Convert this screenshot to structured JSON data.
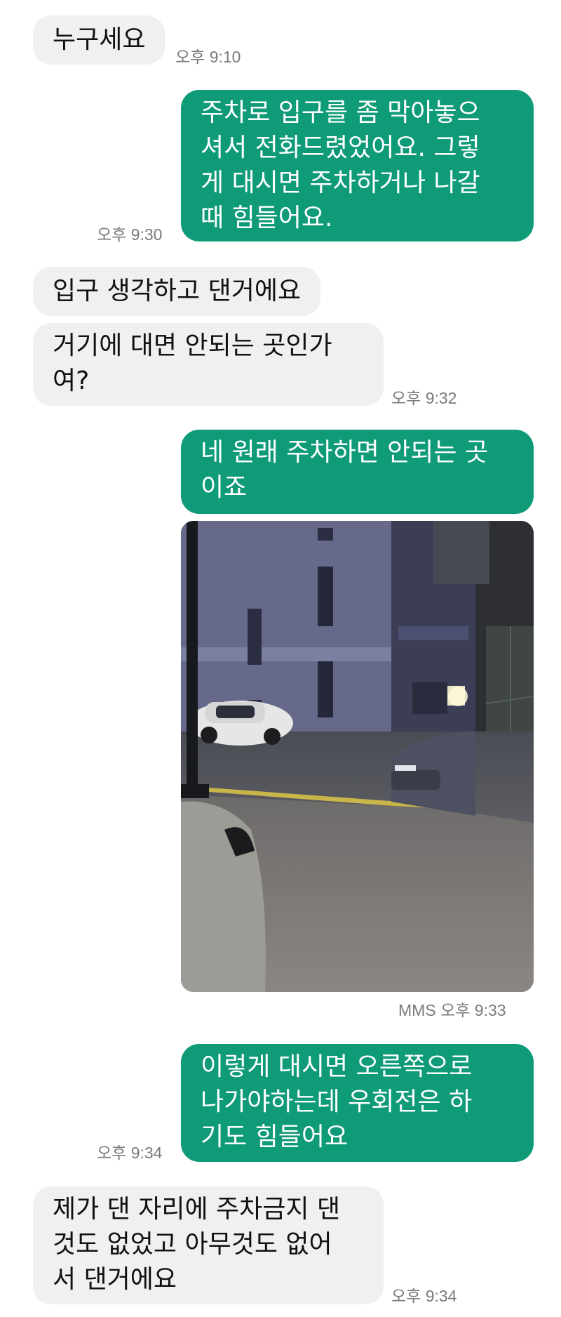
{
  "colors": {
    "sent_bubble": "#0f9b78",
    "received_bubble": "#f0f0f2",
    "timestamp": "#7a7a7a"
  },
  "messages": [
    {
      "direction": "received",
      "text": "누구세요",
      "time": "오후 9:10"
    },
    {
      "direction": "sent",
      "text": "주차로 입구를 좀 막아놓으\n셔서 전화드렸었어요. 그렇\n게 대시면 주차하거나 나갈\n때 힘들어요.",
      "time": "오후 9:30"
    },
    {
      "direction": "received",
      "text": "입구 생각하고 댄거에요"
    },
    {
      "direction": "received",
      "text": "거기에 대면 안되는 곳인가\n여?",
      "time": "오후 9:32"
    },
    {
      "direction": "sent",
      "text": "네 원래 주차하면 안되는 곳\n이죠"
    },
    {
      "direction": "sent",
      "type": "image",
      "label": "MMS",
      "time": "오후 9:33",
      "image": "night-street-parking-photo"
    },
    {
      "direction": "sent",
      "text": "이렇게 대시면 오른쪽으로\n나가야하는데 우회전은 하\n기도 힘들어요",
      "time": "오후 9:34"
    },
    {
      "direction": "received",
      "text": "제가 댄 자리에 주차금지 댄\n것도 없었고 아무것도 없어\n서 댄거에요",
      "time": "오후 9:34"
    }
  ]
}
